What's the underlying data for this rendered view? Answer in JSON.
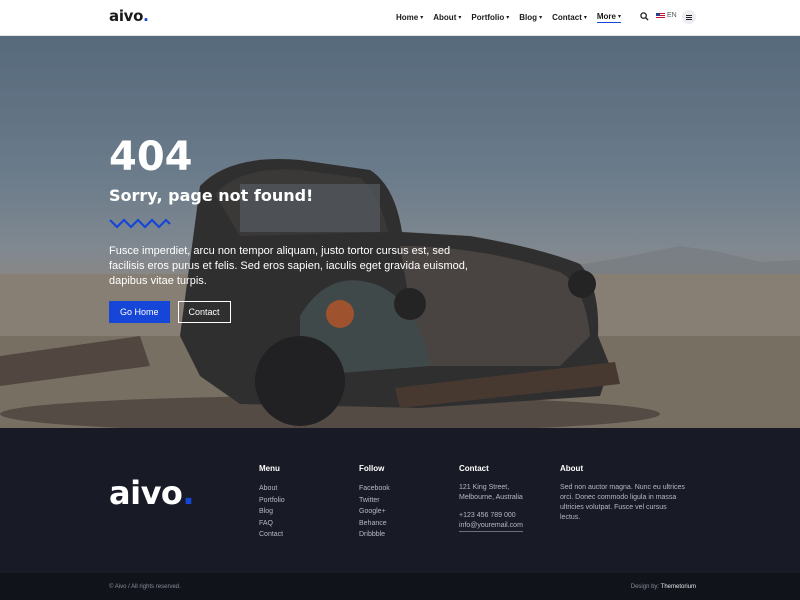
{
  "header": {
    "logo_text": "aivo",
    "nav": [
      {
        "label": "Home",
        "has_dropdown": true
      },
      {
        "label": "About",
        "has_dropdown": true
      },
      {
        "label": "Portfolio",
        "has_dropdown": true
      },
      {
        "label": "Blog",
        "has_dropdown": true
      },
      {
        "label": "Contact",
        "has_dropdown": true
      },
      {
        "label": "More",
        "has_dropdown": true,
        "active": true
      }
    ],
    "search_icon": "search-icon",
    "language": "EN",
    "menu_icon": "hamburger-menu-icon"
  },
  "hero": {
    "code": "404",
    "title": "Sorry, page not found!",
    "description": "Fusce imperdiet, arcu non tempor aliquam, justo tortor cursus est, sed facilisis eros purus et felis. Sed eros sapien, iaculis eget gravida euismod, dapibus vitae turpis.",
    "primary_button": "Go Home",
    "secondary_button": "Contact",
    "background": "photo of abandoned rusty car in desert"
  },
  "footer": {
    "logo_text": "aivo",
    "columns": {
      "menu": {
        "title": "Menu",
        "items": [
          "About",
          "Portfolio",
          "Blog",
          "FAQ",
          "Contact"
        ]
      },
      "follow": {
        "title": "Follow",
        "items": [
          "Facebook",
          "Twitter",
          "Google+",
          "Behance",
          "Dribbble"
        ]
      },
      "contact": {
        "title": "Contact",
        "address_line1": "121 King Street,",
        "address_line2": "Melbourne, Australia",
        "phone": "+123 456 789 000",
        "email": "info@youremail.com"
      },
      "about": {
        "title": "About",
        "text": "Sed non auctor magna. Nunc eu ultrices orci. Donec commodo ligula in massa ultricies volutpat. Fusce vel cursus lectus."
      }
    },
    "copyright": "© Aivo / All rights reserved.",
    "design_label": "Design by:",
    "design_by": "Themetorium"
  },
  "colors": {
    "accent": "#1646d8",
    "footer_bg": "#181a25",
    "header_bg": "#ffffff"
  }
}
